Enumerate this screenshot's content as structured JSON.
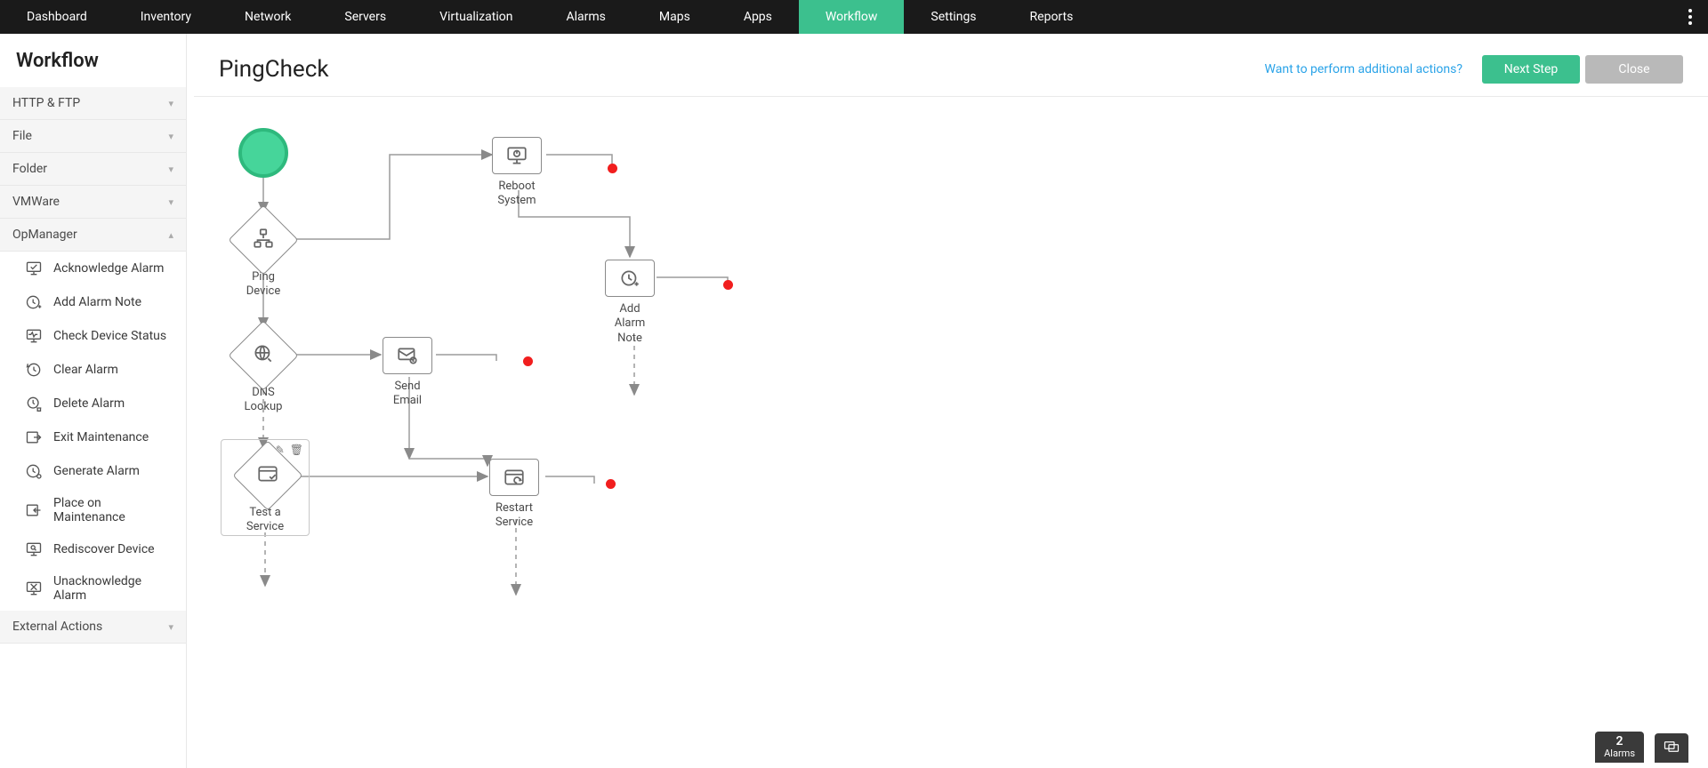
{
  "topnav": {
    "items": [
      "Dashboard",
      "Inventory",
      "Network",
      "Servers",
      "Virtualization",
      "Alarms",
      "Maps",
      "Apps",
      "Workflow",
      "Settings",
      "Reports"
    ],
    "active": "Workflow"
  },
  "sidebar": {
    "title": "Workflow",
    "groups": [
      {
        "label": "HTTP & FTP",
        "expanded": false
      },
      {
        "label": "File",
        "expanded": false
      },
      {
        "label": "Folder",
        "expanded": false
      },
      {
        "label": "VMWare",
        "expanded": false
      },
      {
        "label": "OpManager",
        "expanded": true
      },
      {
        "label": "External Actions",
        "expanded": false
      }
    ],
    "opmanager_items": [
      "Acknowledge Alarm",
      "Add Alarm Note",
      "Check Device Status",
      "Clear Alarm",
      "Delete Alarm",
      "Exit Maintenance",
      "Generate Alarm",
      "Place on Maintenance",
      "Rediscover Device",
      "Unacknowledge Alarm"
    ]
  },
  "header": {
    "title": "PingCheck",
    "additional_link": "Want to perform additional actions?",
    "next_btn": "Next Step",
    "close_btn": "Close"
  },
  "nodes": {
    "ping": "Ping\nDevice",
    "reboot": "Reboot\nSystem",
    "dns": "DNS\nLookup",
    "email": "Send\nEmail",
    "addnote": "Add\nAlarm\nNote",
    "test": "Test a\nService",
    "restart": "Restart\nService"
  },
  "footer": {
    "badge_num": "2",
    "badge_label": "Alarms"
  }
}
